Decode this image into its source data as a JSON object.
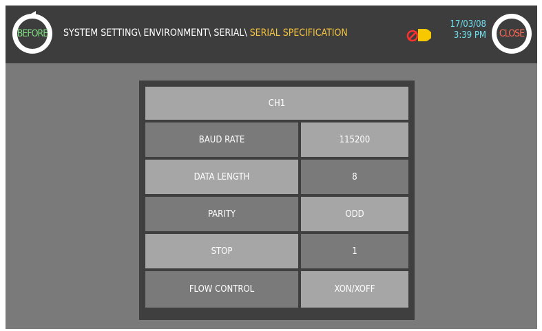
{
  "header": {
    "before_label": "BEFORE",
    "close_label": "CLOSE",
    "breadcrumb_path": "SYSTEM SETTING\\ ENVIRONMENT\\ SERIAL\\ ",
    "breadcrumb_current": "SERIAL SPECIFICATION",
    "date": "17/03/08",
    "time": "3:39 PM"
  },
  "table": {
    "channel": "CH1",
    "rows": [
      {
        "label": "BAUD RATE",
        "value": "115200"
      },
      {
        "label": "DATA LENGTH",
        "value": "8"
      },
      {
        "label": "PARITY",
        "value": "ODD"
      },
      {
        "label": "STOP",
        "value": "1"
      },
      {
        "label": "FLOW CONTROL",
        "value": "XON/XOFF"
      }
    ]
  },
  "icons": {
    "before": "back-arrow-icon",
    "alarm": "alarm-off-icon"
  },
  "colors": {
    "breadcrumb_current": "#f5c441",
    "datetime": "#6fe0f0",
    "before": "#7fd97f",
    "close": "#ff6a5a"
  }
}
